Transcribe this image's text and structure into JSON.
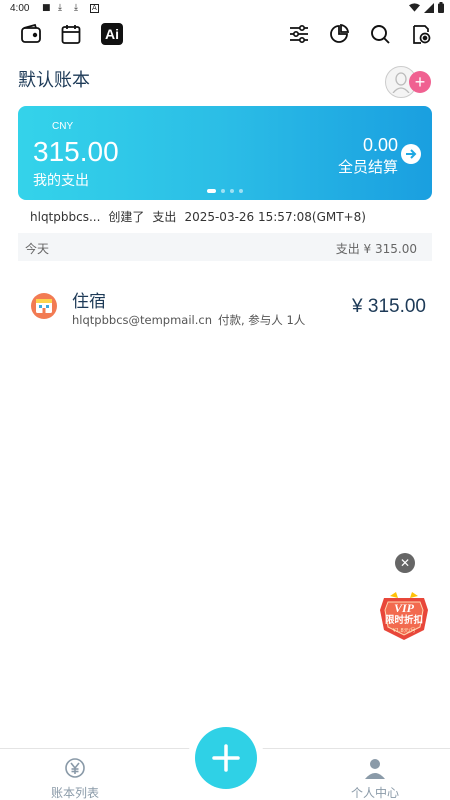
{
  "status_bar": {
    "time": "4:00",
    "notification_icons": [
      "square-icon",
      "download-icon",
      "download-icon",
      "a-icon"
    ],
    "system_icons": [
      "wifi-icon",
      "signal-icon",
      "battery-icon"
    ]
  },
  "toolbar": {
    "ai_label": "Ai",
    "left_icons": [
      "wallet-icon",
      "calendar-icon",
      "ai-icon"
    ],
    "right_icons": [
      "filter-sliders-icon",
      "pie-chart-icon",
      "search-icon",
      "ledger-settings-icon"
    ]
  },
  "book": {
    "title": "默认账本"
  },
  "card": {
    "currency": "CNY",
    "amount": "315.00",
    "amount_label": "我的支出",
    "settle_amount": "0.00",
    "settle_label": "全员结算",
    "page_count": 4,
    "active_page": 1
  },
  "activity": {
    "user": "hlqtpbbcs...",
    "action": "创建了",
    "type": "支出",
    "datetime": "2025-03-26 15:57:08(GMT+8)"
  },
  "day": {
    "label": "今天",
    "total": "支出 ¥ 315.00"
  },
  "records": [
    {
      "category": "住宿",
      "category_icon": "hotel-icon",
      "email": "hlqtpbbcs@tempmail.cn",
      "detail": "付款, 参与人 1人",
      "amount": "¥ 315.00"
    }
  ],
  "promo": {
    "title": "VIP",
    "subtitle": "限时折扣",
    "tag": "¥1.8元/月"
  },
  "bottom_nav": {
    "left_label": "账本列表",
    "right_label": "个人中心",
    "fab_icon": "plus-icon"
  },
  "colors": {
    "accent": "#2fd1e6",
    "card_start": "#34d3ea",
    "card_end": "#1a9fe0",
    "title": "#1d3a57",
    "add_pink": "#f06191",
    "promo_red": "#e8473a"
  }
}
